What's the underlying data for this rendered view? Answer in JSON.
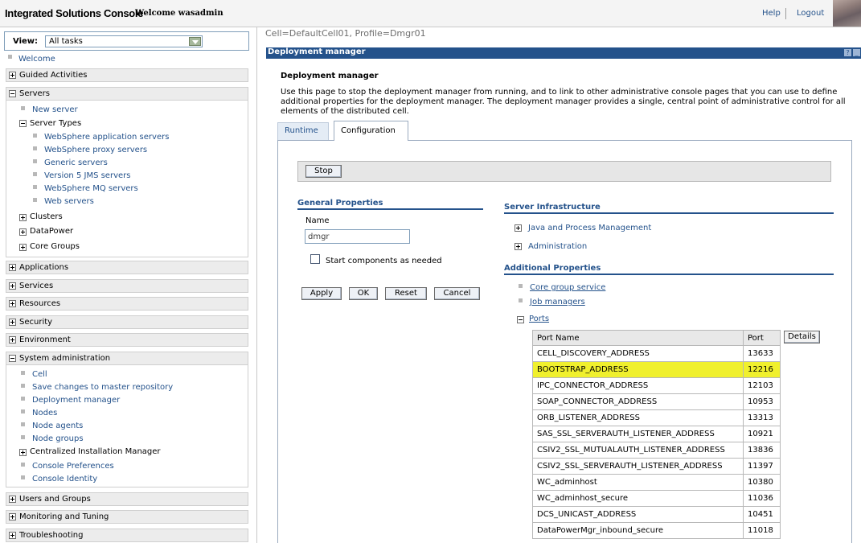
{
  "header": {
    "product": "Integrated Solutions Console",
    "welcome": "Welcome wasadmin",
    "help": "Help",
    "logout": "Logout"
  },
  "nav": {
    "view_label": "View:",
    "view_value": "All tasks",
    "welcome": "Welcome",
    "guided": "Guided Activities",
    "servers": "Servers",
    "new_server": "New server",
    "server_types": "Server Types",
    "server_type_items": [
      "WebSphere application servers",
      "WebSphere proxy servers",
      "Generic servers",
      "Version 5 JMS servers",
      "WebSphere MQ servers",
      "Web servers"
    ],
    "clusters": "Clusters",
    "datapower": "DataPower",
    "core_groups": "Core Groups",
    "applications": "Applications",
    "services": "Services",
    "resources": "Resources",
    "security": "Security",
    "environment": "Environment",
    "sysadmin": "System administration",
    "sysadmin_items": [
      "Cell",
      "Save changes to master repository",
      "Deployment manager",
      "Nodes",
      "Node agents",
      "Node groups"
    ],
    "cim": "Centralized Installation Manager",
    "console_prefs": "Console Preferences",
    "console_identity": "Console Identity",
    "users_groups": "Users and Groups",
    "monitoring": "Monitoring and Tuning",
    "troubleshooting": "Troubleshooting"
  },
  "content": {
    "scope": "Cell=DefaultCell01, Profile=Dmgr01",
    "panel_title": "Deployment manager",
    "page_title": "Deployment manager",
    "description": "Use this page to stop the deployment manager from running, and to link to other administrative console pages that you can use to define additional properties for the deployment manager. The deployment manager provides a single, central point of administrative control for all elements of the distributed cell.",
    "tabs": {
      "runtime": "Runtime",
      "configuration": "Configuration"
    },
    "stop": "Stop",
    "general_properties": "General Properties",
    "name_label": "Name",
    "name_value": "dmgr",
    "start_components": "Start components as needed",
    "buttons": {
      "apply": "Apply",
      "ok": "OK",
      "reset": "Reset",
      "cancel": "Cancel"
    },
    "server_infrastructure": "Server Infrastructure",
    "java_process": "Java and Process Management",
    "administration": "Administration",
    "additional_properties": "Additional Properties",
    "core_group_service": "Core group service",
    "job_managers": "Job managers",
    "ports": "Ports",
    "details": "Details",
    "ports_table": {
      "headers": [
        "Port Name",
        "Port"
      ],
      "rows": [
        [
          "CELL_DISCOVERY_ADDRESS",
          "13633"
        ],
        [
          "BOOTSTRAP_ADDRESS",
          "12216"
        ],
        [
          "IPC_CONNECTOR_ADDRESS",
          "12103"
        ],
        [
          "SOAP_CONNECTOR_ADDRESS",
          "10953"
        ],
        [
          "ORB_LISTENER_ADDRESS",
          "13313"
        ],
        [
          "SAS_SSL_SERVERAUTH_LISTENER_ADDRESS",
          "10921"
        ],
        [
          "CSIV2_SSL_MUTUALAUTH_LISTENER_ADDRESS",
          "13836"
        ],
        [
          "CSIV2_SSL_SERVERAUTH_LISTENER_ADDRESS",
          "11397"
        ],
        [
          "WC_adminhost",
          "10380"
        ],
        [
          "WC_adminhost_secure",
          "11036"
        ],
        [
          "DCS_UNICAST_ADDRESS",
          "10451"
        ],
        [
          "DataPowerMgr_inbound_secure",
          "11018"
        ]
      ]
    }
  }
}
